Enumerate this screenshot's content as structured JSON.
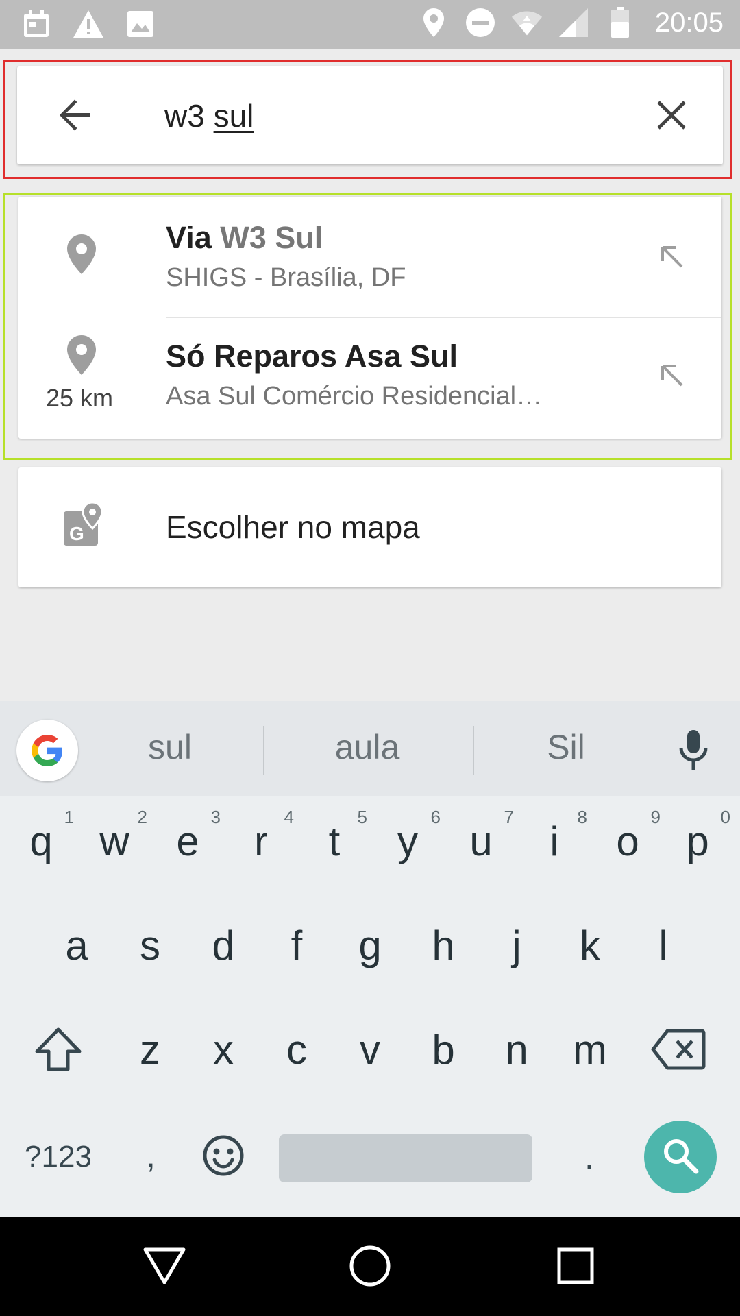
{
  "status_bar": {
    "time": "20:05",
    "left_icons": [
      "calendar-icon",
      "warning-icon",
      "image-icon"
    ],
    "right_icons": [
      "location-icon",
      "do-not-disturb-icon",
      "wifi-icon",
      "signal-icon",
      "battery-icon"
    ]
  },
  "search": {
    "query_prefix": "w3 ",
    "query_composing": "sul",
    "back_icon": "arrow-back-icon",
    "clear_icon": "close-icon"
  },
  "suggestions": [
    {
      "title_plain": "Via ",
      "title_highlight": "W3 Sul",
      "subtitle": "SHIGS - Brasília, DF",
      "distance": "",
      "icon": "place-pin-icon"
    },
    {
      "title_plain": "Só Reparos Asa Sul",
      "title_highlight": "",
      "subtitle": "Asa Sul Comércio Residencial…",
      "distance": "25 km",
      "icon": "place-pin-icon"
    }
  ],
  "choose_on_map": {
    "label": "Escolher no mapa",
    "icon": "map-pin-icon"
  },
  "keyboard": {
    "suggestions": [
      "sul",
      "aula",
      "Sil"
    ],
    "row1": [
      {
        "key": "q",
        "num": "1"
      },
      {
        "key": "w",
        "num": "2"
      },
      {
        "key": "e",
        "num": "3"
      },
      {
        "key": "r",
        "num": "4"
      },
      {
        "key": "t",
        "num": "5"
      },
      {
        "key": "y",
        "num": "6"
      },
      {
        "key": "u",
        "num": "7"
      },
      {
        "key": "i",
        "num": "8"
      },
      {
        "key": "o",
        "num": "9"
      },
      {
        "key": "p",
        "num": "0"
      }
    ],
    "row2": [
      "a",
      "s",
      "d",
      "f",
      "g",
      "h",
      "j",
      "k",
      "l"
    ],
    "row3": [
      "z",
      "x",
      "c",
      "v",
      "b",
      "n",
      "m"
    ],
    "symbols_label": "?123",
    "comma": ",",
    "period": ".",
    "accent": "#4db6ac"
  },
  "nav_bar": {
    "icons": [
      "back-triangle-icon",
      "home-circle-icon",
      "recents-square-icon"
    ]
  }
}
